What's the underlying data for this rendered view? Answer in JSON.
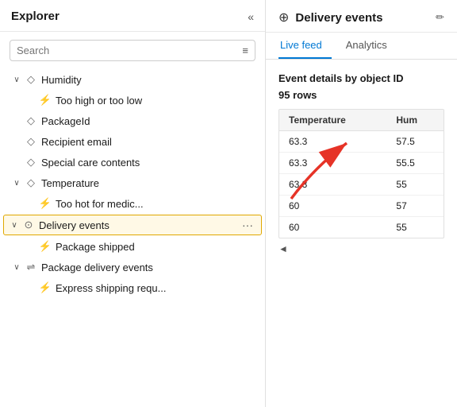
{
  "explorer": {
    "title": "Explorer",
    "collapse_label": "«",
    "search": {
      "placeholder": "Search",
      "value": ""
    },
    "tree": [
      {
        "id": "humidity",
        "level": 1,
        "label": "Humidity",
        "icon": "diamond",
        "chevron": "∨",
        "type": "parent"
      },
      {
        "id": "humidity-alert",
        "level": 2,
        "label": "Too high or too low",
        "icon": "lightning",
        "type": "child"
      },
      {
        "id": "packageid",
        "level": 1,
        "label": "PackageId",
        "icon": "diamond",
        "type": "leaf"
      },
      {
        "id": "recipient-email",
        "level": 1,
        "label": "Recipient email",
        "icon": "diamond",
        "type": "leaf"
      },
      {
        "id": "special-care",
        "level": 1,
        "label": "Special care contents",
        "icon": "diamond",
        "type": "leaf"
      },
      {
        "id": "temperature",
        "level": 1,
        "label": "Temperature",
        "icon": "diamond",
        "chevron": "∨",
        "type": "parent"
      },
      {
        "id": "temperature-alert",
        "level": 2,
        "label": "Too hot for medic...",
        "icon": "lightning",
        "type": "child"
      },
      {
        "id": "delivery-events",
        "level": 1,
        "label": "Delivery events",
        "icon": "hub",
        "chevron": "∨",
        "type": "parent",
        "highlighted": true,
        "has_more": true
      },
      {
        "id": "package-shipped",
        "level": 2,
        "label": "Package shipped",
        "icon": "lightning",
        "type": "child"
      },
      {
        "id": "package-delivery",
        "level": 1,
        "label": "Package delivery events",
        "icon": "stream",
        "chevron": "∨",
        "type": "parent"
      },
      {
        "id": "express-shipping",
        "level": 2,
        "label": "Express shipping requ...",
        "icon": "lightning",
        "type": "child"
      }
    ]
  },
  "right_panel": {
    "icon": "⊕",
    "title": "Delivery events",
    "edit_icon": "✏",
    "tabs": [
      {
        "id": "live-feed",
        "label": "Live feed",
        "active": true
      },
      {
        "id": "analytics",
        "label": "Analytics",
        "active": false
      }
    ],
    "section_title": "Event details by object ID",
    "row_count": "95 rows",
    "table": {
      "columns": [
        "Temperature",
        "Hum"
      ],
      "rows": [
        {
          "temperature": "63.3",
          "humidity": "57.5"
        },
        {
          "temperature": "63.3",
          "humidity": "55.5"
        },
        {
          "temperature": "63.3",
          "humidity": "55"
        },
        {
          "temperature": "60",
          "humidity": "57"
        },
        {
          "temperature": "60",
          "humidity": "55"
        }
      ]
    }
  },
  "colors": {
    "accent": "#0078d4",
    "highlight_border": "#e0a800",
    "highlight_bg": "#fff9e6",
    "arrow_color": "#e63327"
  }
}
